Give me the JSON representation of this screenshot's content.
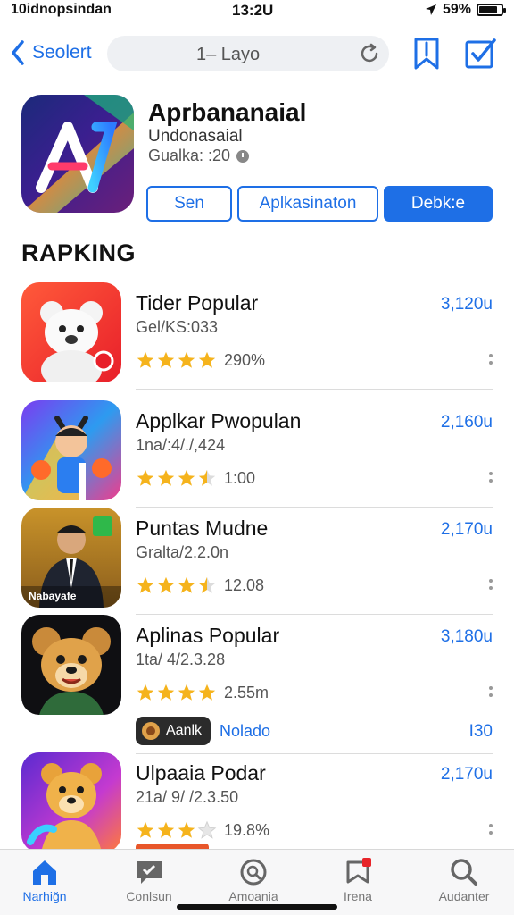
{
  "status_bar": {
    "carrier": "10idnopsindan",
    "time": "13:2U",
    "battery": "59%"
  },
  "nav": {
    "back_label": "Seolert",
    "url": "1– Layo"
  },
  "app": {
    "title": "Aprbananaial",
    "subtitle": "Undonasaial",
    "rating": "Gualka: :20",
    "buttons": [
      "Sen",
      "Aplkasinaton",
      "Debk:e"
    ]
  },
  "section_title": "RAPKING",
  "apps": [
    {
      "name": "Tider Popular",
      "meta": "Gel/KS:033",
      "rating": "290%",
      "stars": 4,
      "count": "3,120u"
    },
    {
      "name": "Applkar Pwopulan",
      "meta": "1na/:4/./,424",
      "rating": "1:00",
      "stars": 3.5,
      "count": "2,160u"
    },
    {
      "name": "Puntas Mudne",
      "meta": "Gralta/2.2.0n",
      "rating": "12.08",
      "stars": 3.5,
      "count": "2,170u",
      "badge": "Nabayafe"
    },
    {
      "name": "Aplinas Popular",
      "meta": "1ta/ 4/2.3.28",
      "rating": "2.55m",
      "stars": 4,
      "count": "3,180u",
      "tag": "Aanlk",
      "tag_right": "Nolado",
      "tag_count": "I30"
    },
    {
      "name": "Ulpaaia Podar",
      "meta": "21a/ 9/ /2.3.50",
      "rating": "19.8%",
      "stars": 3,
      "count": "2,170u"
    }
  ],
  "tabs": [
    {
      "label": "Narhiğn",
      "icon": "home-icon",
      "active": true
    },
    {
      "label": "Conlsun",
      "icon": "chat-icon",
      "active": false
    },
    {
      "label": "Amoania",
      "icon": "search-circle-icon",
      "active": false
    },
    {
      "label": "Irena",
      "icon": "bookmark-icon",
      "active": false
    },
    {
      "label": "Audanter",
      "icon": "search-icon",
      "active": false
    }
  ],
  "colors": {
    "accent": "#1e6fe6",
    "star": "#f5b31c"
  }
}
